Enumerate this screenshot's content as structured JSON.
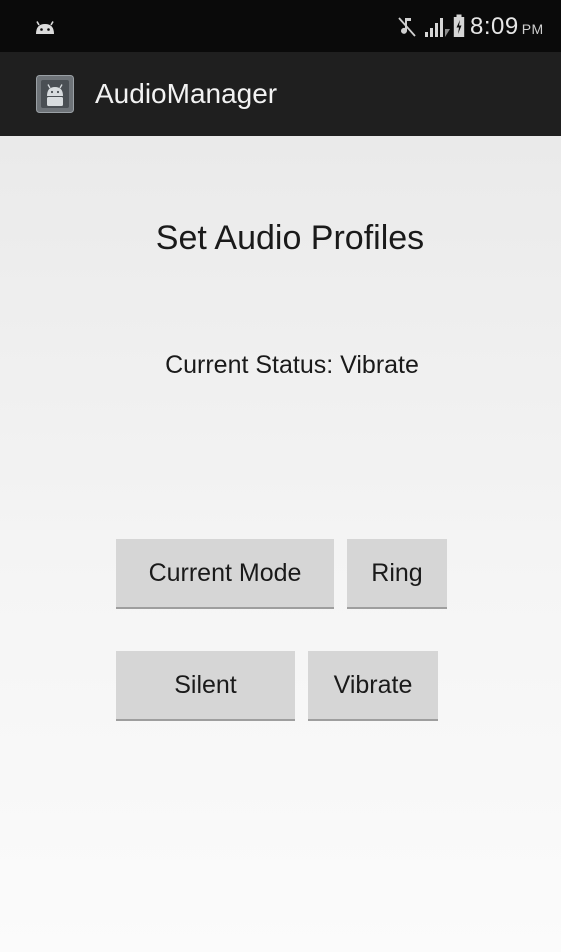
{
  "status_bar": {
    "time": "8:09",
    "ampm": "PM",
    "icons": [
      "android-notification-icon",
      "mute-icon",
      "signal-icon",
      "battery-icon"
    ]
  },
  "action_bar": {
    "title": "AudioManager",
    "icon": "app-icon"
  },
  "main": {
    "title": "Set Audio Profiles",
    "status_text": "Current Status: Vibrate",
    "buttons": {
      "current_mode": "Current Mode",
      "ring": "Ring",
      "silent": "Silent",
      "vibrate": "Vibrate"
    }
  },
  "colors": {
    "status_bar_bg": "#0a0a0a",
    "action_bar_bg": "#1f1f1f",
    "content_bg": "#f0f0f0",
    "button_bg": "#d6d6d6"
  }
}
